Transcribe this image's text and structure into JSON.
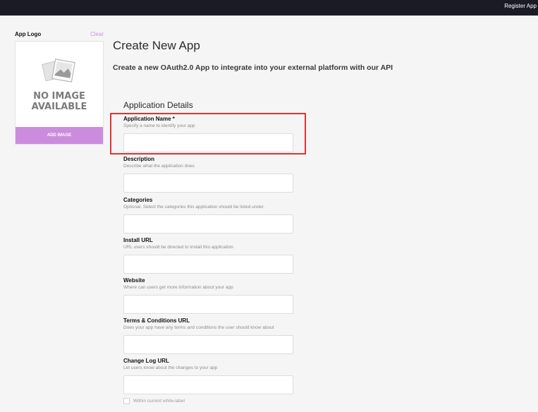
{
  "header": {
    "register_link": "Register App"
  },
  "logo": {
    "label": "App Logo",
    "clear": "Clear",
    "placeholder_line1": "NO IMAGE",
    "placeholder_line2": "AVAILABLE",
    "add_button": "ADD IMAGE"
  },
  "page": {
    "title": "Create New App",
    "subtitle": "Create a new OAuth2.0 App to integrate into your external platform with our API",
    "section": "Application Details"
  },
  "fields": [
    {
      "label": "Application Name *",
      "help": "Specify a name to identify your app",
      "value": ""
    },
    {
      "label": "Description",
      "help": "Describe what the application does",
      "value": ""
    },
    {
      "label": "Categories",
      "help": "Optional. Select the categories this application should be listed under.",
      "value": ""
    },
    {
      "label": "Install URL",
      "help": "URL users should be directed to install this application",
      "value": ""
    },
    {
      "label": "Website",
      "help": "Where can users get more information about your app",
      "value": ""
    },
    {
      "label": "Terms & Conditions URL",
      "help": "Does your app have any terms and conditions the user should know about",
      "value": ""
    },
    {
      "label": "Change Log URL",
      "help": "Let users know about the changes to your app",
      "value": ""
    }
  ],
  "checkbox": {
    "label": "Within current white-label",
    "checked": false
  },
  "colors": {
    "topbar": "#1b1b26",
    "accent": "#cc8cdd",
    "highlight": "#e03232"
  },
  "icons": {
    "logo_placeholder": "photo-icon"
  }
}
